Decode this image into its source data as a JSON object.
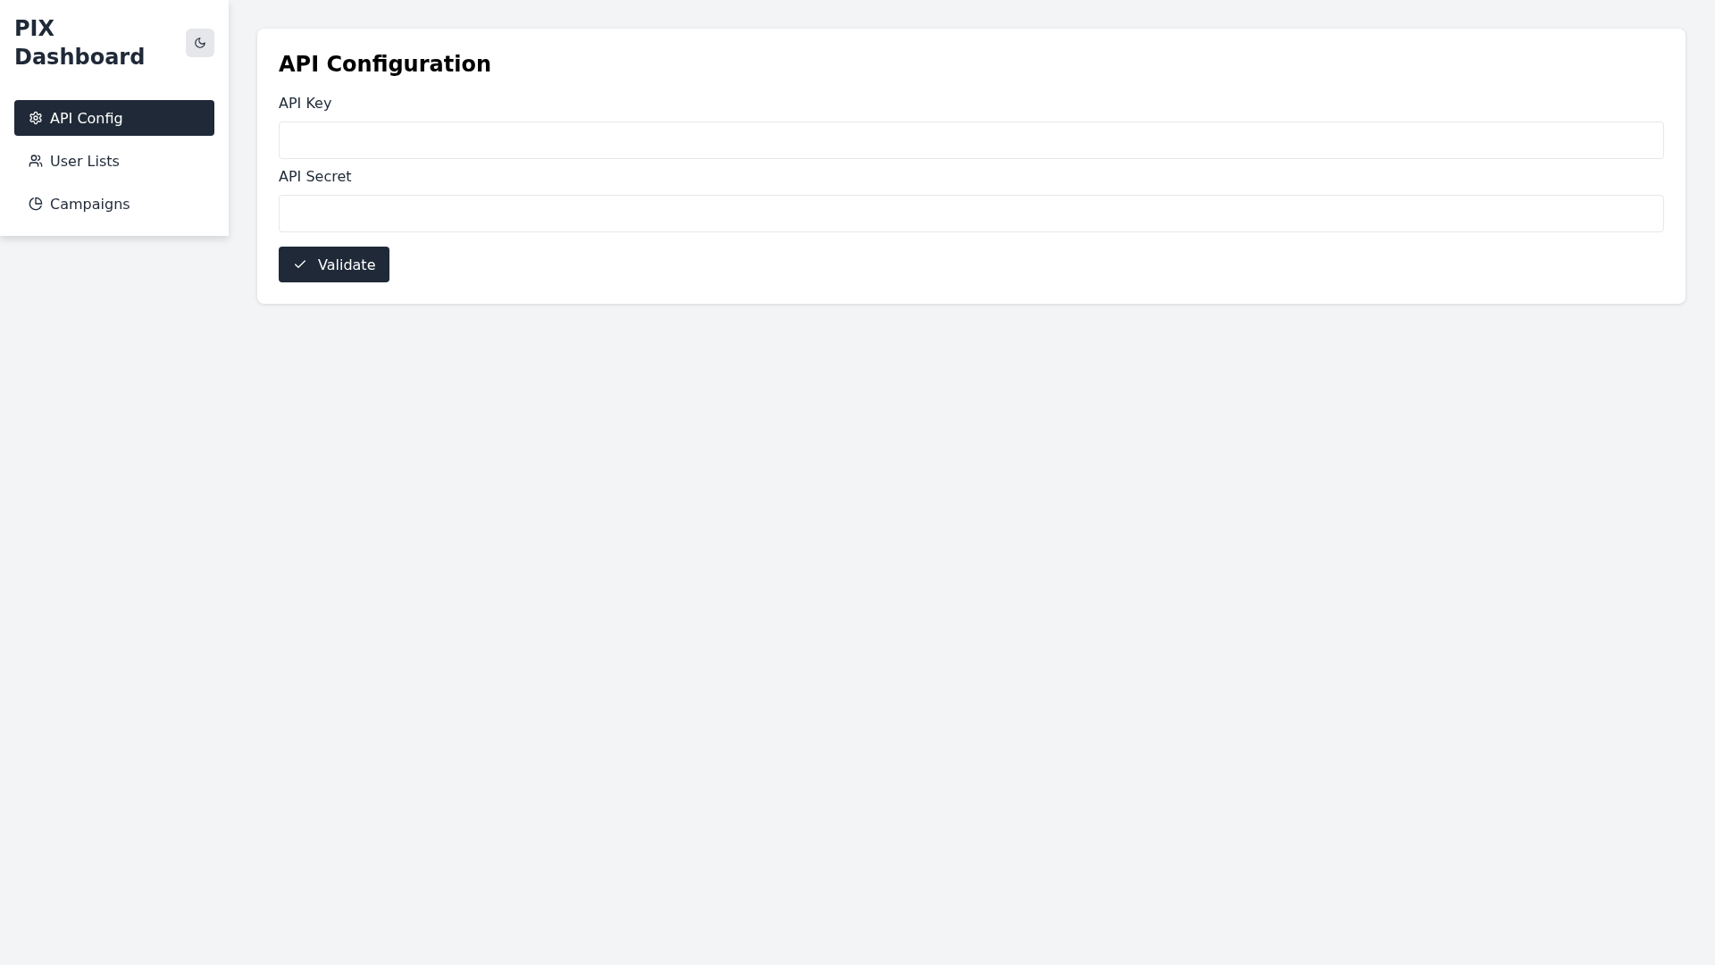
{
  "sidebar": {
    "title": "PIX Dashboard",
    "items": [
      {
        "label": "API Config",
        "selected": true
      },
      {
        "label": "User Lists",
        "selected": false
      },
      {
        "label": "Campaigns",
        "selected": false
      }
    ]
  },
  "main": {
    "heading": "API Configuration",
    "fields": [
      {
        "label": "API Key"
      },
      {
        "label": "API Secret"
      }
    ],
    "button": "Validate"
  }
}
